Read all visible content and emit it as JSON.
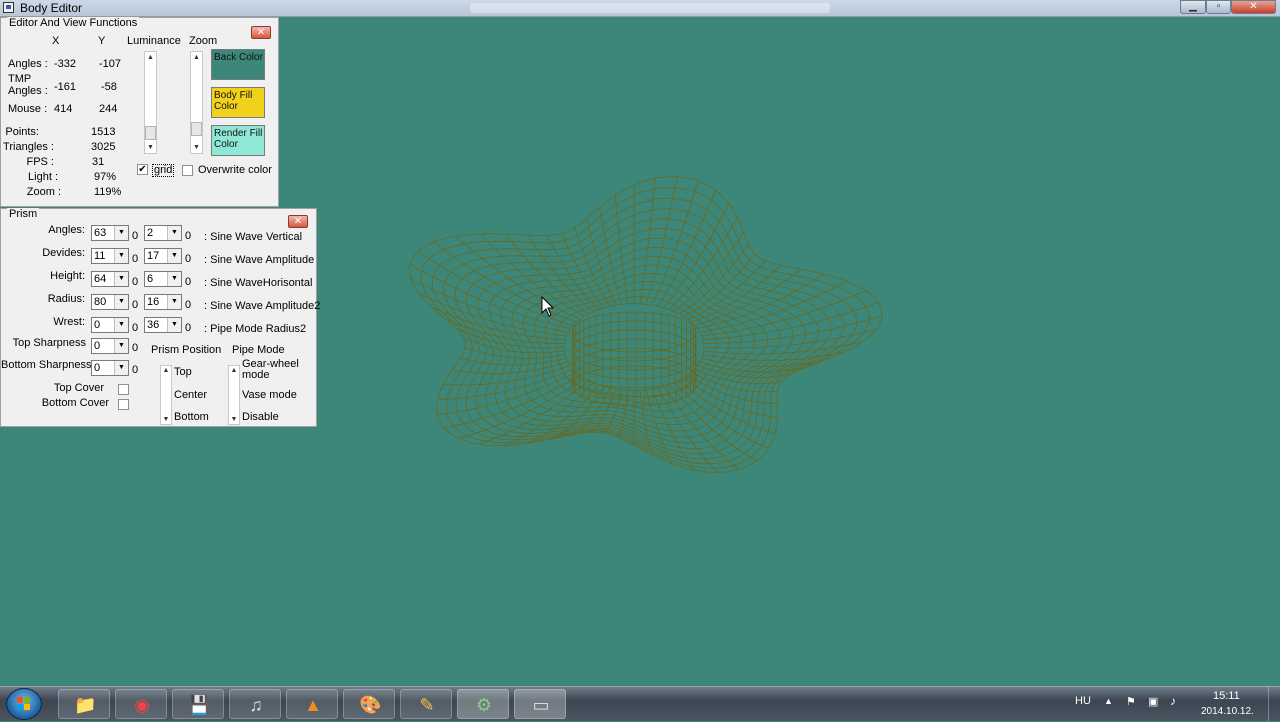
{
  "window": {
    "title": "Body Editor"
  },
  "editor_panel": {
    "title": "Editor And View Functions",
    "col_x": "X",
    "col_y": "Y",
    "col_luminance": "Luminance",
    "col_zoom": "Zoom",
    "rows": [
      {
        "label": "Angles :",
        "x": "-332",
        "y": "-107"
      },
      {
        "label": "TMP\nAngles :",
        "x": "-161",
        "y": "-58"
      },
      {
        "label": "Mouse :",
        "x": "414",
        "y": "244"
      }
    ],
    "stats": [
      {
        "label": "Points:",
        "value": "1513"
      },
      {
        "label": "Triangles :",
        "value": "3025"
      },
      {
        "label": "FPS :",
        "value": "31"
      },
      {
        "label": "Light :",
        "value": "97%"
      },
      {
        "label": "Zoom :",
        "value": "119%"
      }
    ],
    "back_color_label": "Back Color",
    "body_fill_label": "Body Fill Color",
    "render_fill_label": "Render Fill Color",
    "grid_label": "grid",
    "grid_checked": true,
    "overwrite_label": "Overwrite color",
    "overwrite_checked": false,
    "back_color": "#3d877a",
    "body_fill_color": "#f2d11a",
    "render_fill_color": "#8fe8d6"
  },
  "prism_panel": {
    "title": "Prism",
    "rows": [
      {
        "label": "Angles:",
        "v1": "63",
        "v2": "2",
        "desc": ": Sine Wave Vertical"
      },
      {
        "label": "Devides:",
        "v1": "11",
        "v2": "17",
        "desc": ": Sine Wave Amplitude"
      },
      {
        "label": "Height:",
        "v1": "64",
        "v2": "6",
        "desc": ": Sine WaveHorisontal"
      },
      {
        "label": "Radius:",
        "v1": "80",
        "v2": "16",
        "desc": ": Sine Wave Amplitude2"
      },
      {
        "label": "Wrest:",
        "v1": "0",
        "v2": "36",
        "desc": ": Pipe Mode Radius2"
      }
    ],
    "zero_label": "0",
    "top_sharpness_label": "Top Sharpness",
    "top_sharpness_value": "0",
    "bottom_sharpness_label": "Bottom Sharpness",
    "bottom_sharpness_value": "0",
    "top_cover_label": "Top Cover",
    "bottom_cover_label": "Bottom Cover",
    "prism_position_label": "Prism Position",
    "position_options": [
      "Top",
      "Center",
      "Bottom"
    ],
    "pipe_mode_label": "Pipe Mode",
    "pipe_options": [
      "Gear-wheel\nmode",
      "Vase mode",
      "Disable"
    ]
  },
  "taskbar": {
    "language": "HU",
    "time": "15:11",
    "date": "2014.10.12.",
    "apps": [
      "windows-explorer-icon",
      "chrome-icon",
      "save-disk-icon",
      "music-notes-icon",
      "vlc-icon",
      "paint-icon",
      "pencil-app-icon",
      "body-editor-icon",
      "window-icon"
    ]
  },
  "colors": {
    "mesh": "#6d6410",
    "background": "#3d877a"
  }
}
